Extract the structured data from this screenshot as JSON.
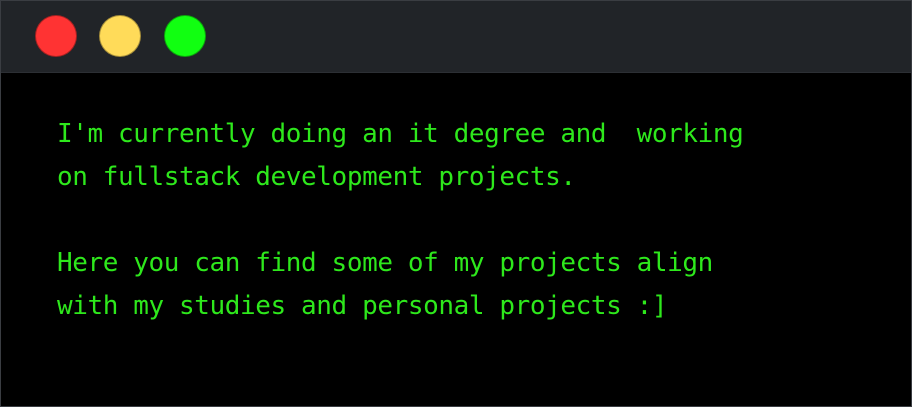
{
  "window": {
    "controls": {
      "close_color": "#ff3333",
      "minimize_color": "#ffdb59",
      "maximize_color": "#11ff11"
    }
  },
  "terminal": {
    "text_color": "#2ee81c",
    "paragraphs": [
      {
        "lines": [
          "I'm currently doing an it degree and  working",
          "on fullstack development projects."
        ]
      },
      {
        "lines": [
          "Here you can find some of my projects align",
          "with my studies and personal projects :]"
        ]
      }
    ]
  }
}
